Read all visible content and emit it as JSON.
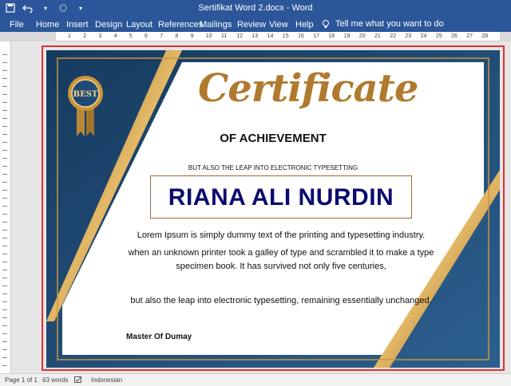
{
  "window": {
    "title": "Sertifikat Word 2.docx  -  Word"
  },
  "ribbon": {
    "tabs": [
      "File",
      "Home",
      "Insert",
      "Design",
      "Layout",
      "References",
      "Mailings",
      "Review",
      "View",
      "Help"
    ],
    "tell_me": "Tell me what you want to do"
  },
  "ruler": {
    "ticks": [
      "1",
      "2",
      "3",
      "4",
      "5",
      "6",
      "7",
      "8",
      "9",
      "10",
      "11",
      "12",
      "13",
      "14",
      "15",
      "16",
      "17",
      "18",
      "19",
      "20",
      "21",
      "22",
      "23",
      "24",
      "25",
      "26",
      "27",
      "28"
    ]
  },
  "certificate": {
    "title": "Certificate",
    "subtitle": "OF ACHIEVEMENT",
    "leap_line": "BUT ALSO THE LEAP INTO ELECTRONIC TYPESETTING",
    "name": "RIANA ALI NURDIN",
    "paragraph_1": "Lorem Ipsum is simply dummy text of the printing and typesetting industry.",
    "paragraph_2": "when an unknown printer took a galley of type and scrambled it to make a type specimen book. It has survived not only five centuries,",
    "paragraph_3": "but also the leap into electronic typesetting, remaining essentially unchanged.",
    "signature": "Master Of Dumay",
    "badge_text": "BEST",
    "colors": {
      "navy": "#1f4a75",
      "gold": "#c9963c",
      "name": "#0b0b6e"
    }
  },
  "statusbar": {
    "page": "Page 1 of 1",
    "words": "63 words",
    "language": "Indonesian"
  }
}
